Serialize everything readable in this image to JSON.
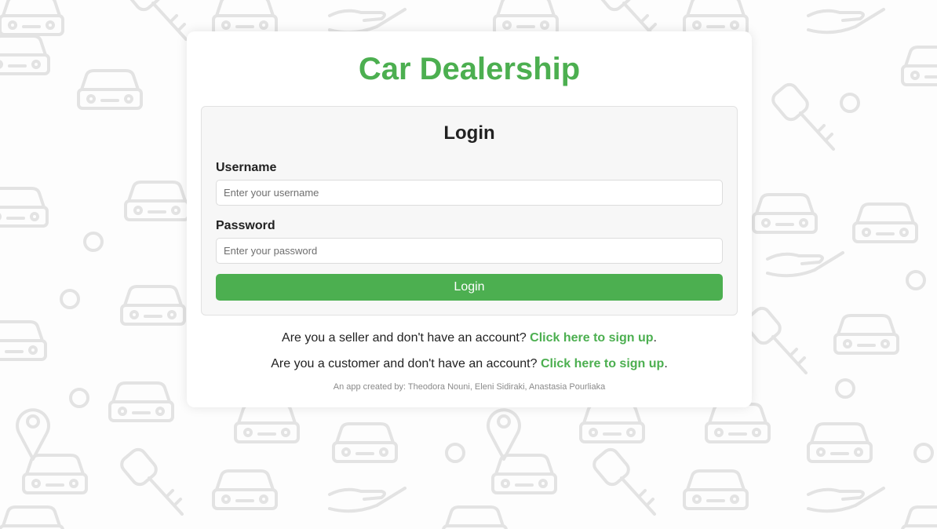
{
  "app": {
    "title": "Car Dealership",
    "accent_color": "#4caf50",
    "background_pattern": "car-dealership-line-icons"
  },
  "login": {
    "heading": "Login",
    "username_label": "Username",
    "username_placeholder": "Enter your username",
    "username_value": "",
    "password_label": "Password",
    "password_placeholder": "Enter your password",
    "password_value": "",
    "submit_label": "Login"
  },
  "signup": {
    "seller_prompt": "Are you a seller and don't have an account? ",
    "seller_link": "Click here to sign up",
    "customer_prompt": "Are you a customer and don't have an account? ",
    "customer_link": "Click here to sign up",
    "trailing_punct": "."
  },
  "footer": {
    "credits": "An app created by: Theodora Nouni, Eleni Sidiraki, Anastasia Pourliaka"
  }
}
